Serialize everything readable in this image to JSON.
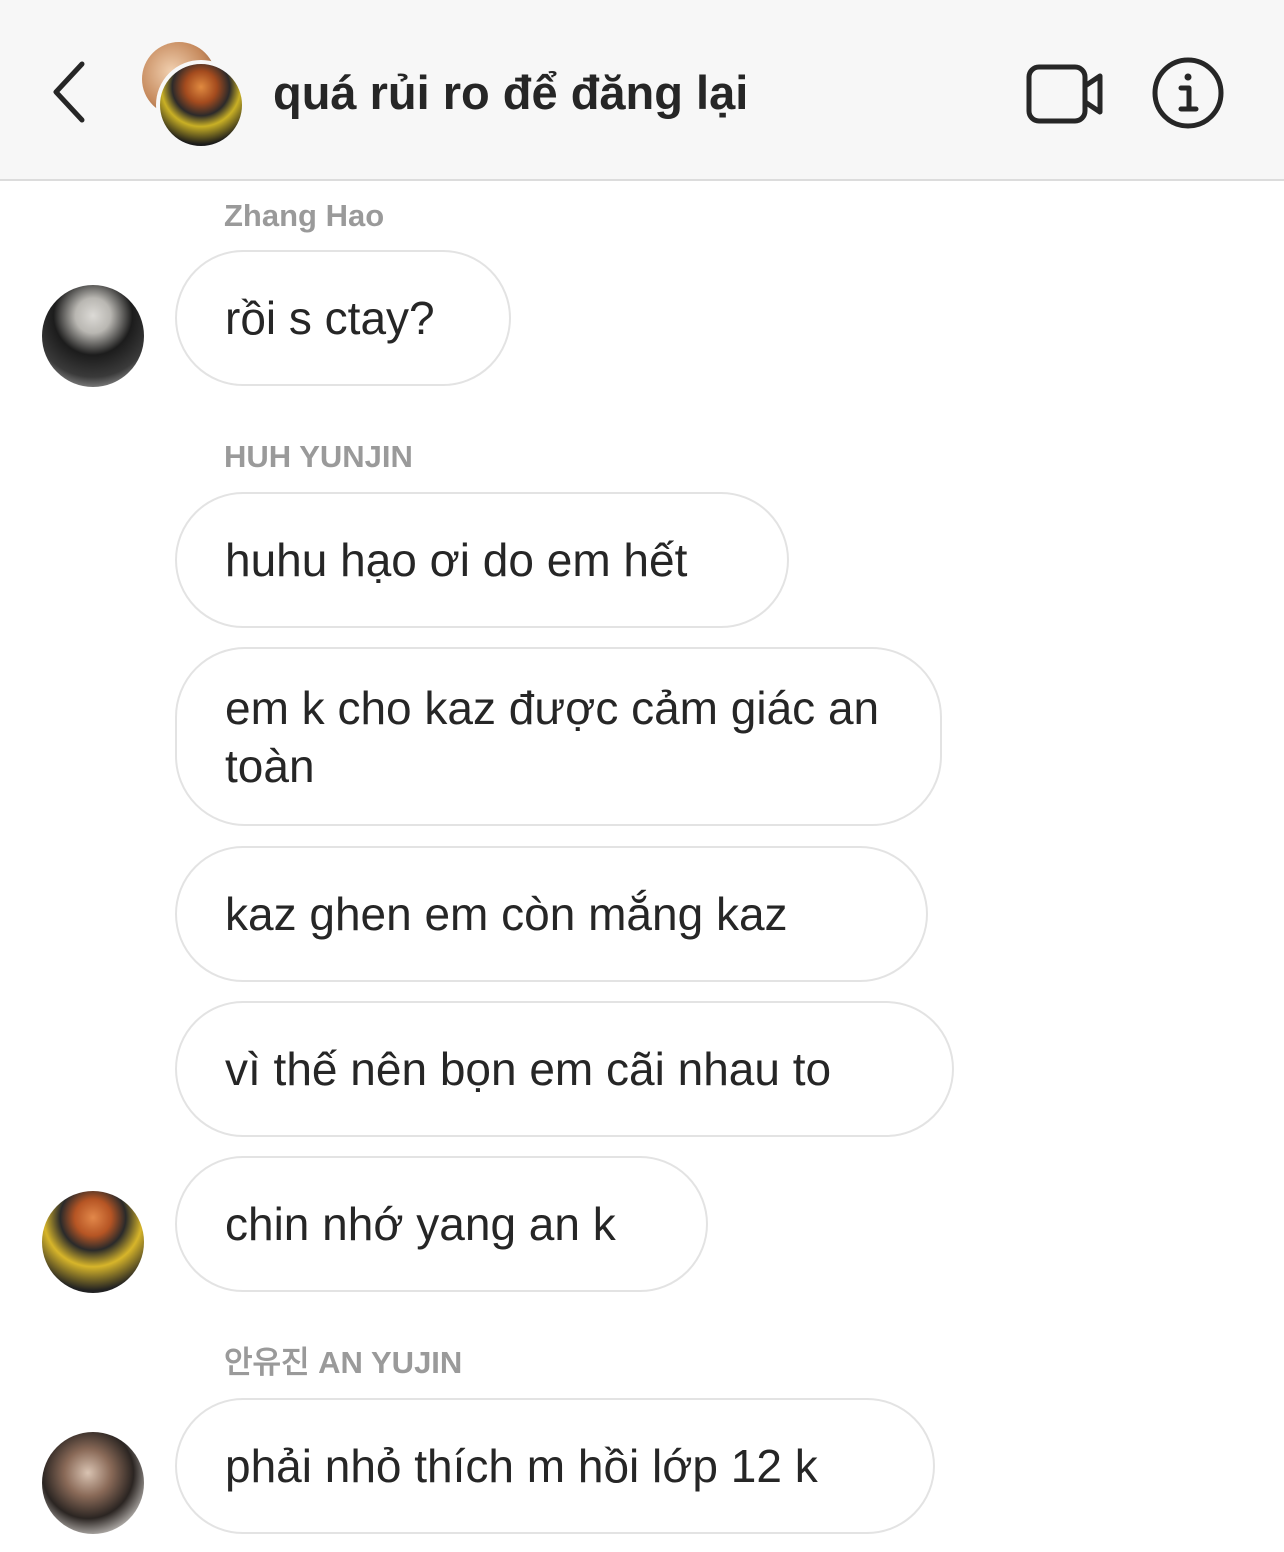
{
  "header": {
    "title": "quá rủi ro để đăng lại",
    "back_icon": "chevron-left-icon",
    "video_icon": "video-camera-icon",
    "info_icon": "info-icon"
  },
  "messages": [
    {
      "sender": "Zhang Hao",
      "text": "rồi s ctay?"
    },
    {
      "sender": "HUH YUNJIN",
      "text": "huhu hạo ơi do em hết"
    },
    {
      "sender": "",
      "text": "em k cho kaz được cảm giác an toàn"
    },
    {
      "sender": "",
      "text": "kaz ghen em còn mắng kaz"
    },
    {
      "sender": "",
      "text": "vì thế nên bọn em cãi nhau to"
    },
    {
      "sender": "",
      "text": "chin nhớ yang an k"
    },
    {
      "sender": "안유진 AN YUJIN",
      "text": "phải nhỏ thích m hồi lớp 12 k"
    }
  ]
}
